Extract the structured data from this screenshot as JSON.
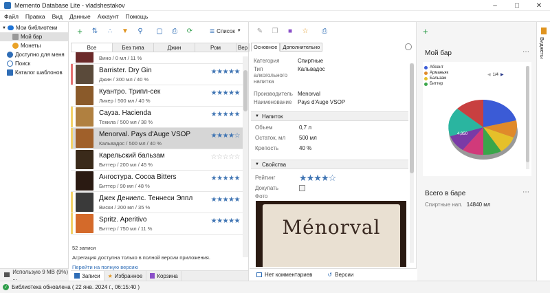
{
  "window": {
    "title": "Memento Database Lite - vladshestakov"
  },
  "menu": [
    "Файл",
    "Правка",
    "Вид",
    "Данные",
    "Аккаунт",
    "Помощь"
  ],
  "sidebar": {
    "items": [
      {
        "label": "Мои библиотеки"
      },
      {
        "label": "Мой бар"
      },
      {
        "label": "Монеты"
      },
      {
        "label": "Доступно для меня"
      },
      {
        "label": "Поиск"
      },
      {
        "label": "Каталог шаблонов"
      }
    ],
    "storage": "Использую 9 MB (9%) ..."
  },
  "list": {
    "view_select": "Список",
    "tabs": [
      "Все",
      "Без типа",
      "Джин",
      "Ром",
      "Вер"
    ],
    "rows": [
      {
        "name": "Бариста",
        "sub": "Вино / 0 мл / 11 %",
        "rating": 5,
        "bar": "#fff",
        "thumb": "#6b2a2a"
      },
      {
        "name": "Barrister. Dry Gin",
        "sub": "Джин / 300 мл / 40 %",
        "rating": 5,
        "bar": "#e57373",
        "thumb": "#5a4a3a"
      },
      {
        "name": "Куантро. Трипл-сек",
        "sub": "Ликер / 500 мл / 40 %",
        "rating": 5,
        "bar": "#fff",
        "thumb": "#8a5a2a"
      },
      {
        "name": "Сауза. Hacienda",
        "sub": "Текила / 500 мл / 38 %",
        "rating": 5,
        "bar": "#f3d36b",
        "thumb": "#b08040"
      },
      {
        "name": "Menorval. Pays d'Auge VSOP",
        "sub": "Кальвадос / 500 мл / 40 %",
        "rating": 4,
        "bar": "#f3d36b",
        "thumb": "#a0602a",
        "selected": true
      },
      {
        "name": "Карельский бальзам",
        "sub": "Биттер / 200 мл / 45 %",
        "rating": 0,
        "bar": "#fff",
        "thumb": "#3a2a1a"
      },
      {
        "name": "Ангостура. Cocoa Bitters",
        "sub": "Биттер / 90 мл / 48 %",
        "rating": 5,
        "bar": "#fff",
        "thumb": "#2a1a12"
      },
      {
        "name": "Джек Дениелс. Теннеси Эппл",
        "sub": "Виски / 200 мл / 35 %",
        "rating": 5,
        "bar": "#f3d36b",
        "thumb": "#3a3a3a"
      },
      {
        "name": "Spritz. Aperitivo",
        "sub": "Биттер / 750 мл / 11 %",
        "rating": 5,
        "bar": "#f3d36b",
        "thumb": "#d46a2a"
      }
    ],
    "count": "52 записи",
    "aggregation_note": "Агрегация доступна только в полной версии приложения.",
    "upgrade_link": "Перейти на полную версию",
    "bottom_tabs": [
      "Записи",
      "Избранное",
      "Корзина"
    ]
  },
  "detail": {
    "tabs": [
      "Основное",
      "Дополнительно"
    ],
    "fields": [
      {
        "label": "Категория",
        "value": "Спиртные"
      },
      {
        "label": "Тип алкогольного напитка",
        "value": "Кальвадос"
      },
      {
        "label": "Производитель",
        "value": "Menorval"
      },
      {
        "label": "Наименование",
        "value": "Pays d'Auge VSOP"
      }
    ],
    "drink_section": "Напиток",
    "drink": [
      {
        "label": "Объем",
        "value": "0,7 л"
      },
      {
        "label": "Остаток, мл",
        "value": "500 мл"
      },
      {
        "label": "Крепость",
        "value": "40 %"
      }
    ],
    "props_section": "Свойства",
    "rating_label": "Рейтинг",
    "rating": 4,
    "buy_label": "Докупать",
    "photo_label": "Фото",
    "photo_text": "Ménorval",
    "bottom": [
      "Нет комментариев",
      "Версии"
    ]
  },
  "widgets": {
    "bar_title": "Мой бар",
    "legend": [
      "Абсент",
      "Арманьяк",
      "Бальзам",
      "Биттер"
    ],
    "legend_colors": [
      "#3b5bd6",
      "#e08a2a",
      "#e6c02a",
      "#3aa64a"
    ],
    "pager": "1/4",
    "pie_label": "4,950",
    "total_title": "Всего в баре",
    "total_label": "Спиртные нап.",
    "total_value": "14840 мл",
    "side_label": "Виджеты"
  },
  "status": "Библиотека обновлена ( 22 янв. 2024 г., 06:15:40 )"
}
